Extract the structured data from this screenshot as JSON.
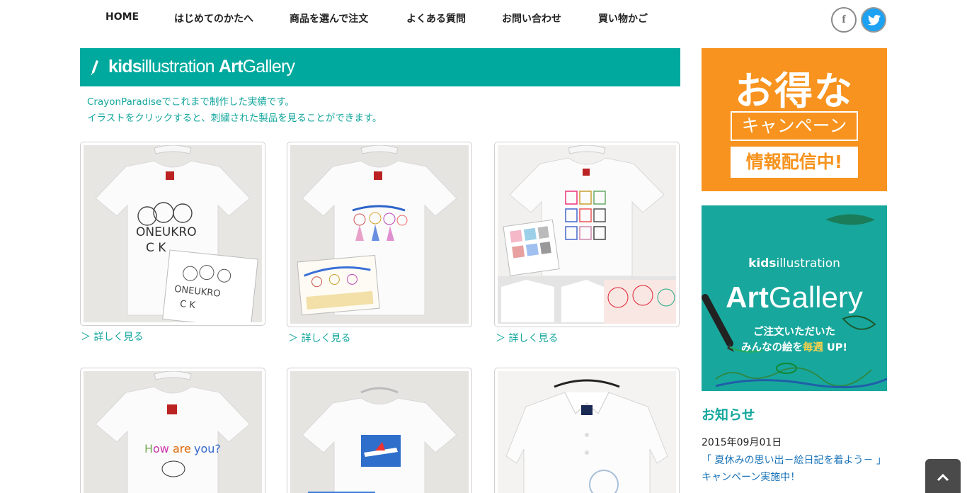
{
  "nav": {
    "items": [
      {
        "label": "HOME"
      },
      {
        "label": "はじめてのかたへ"
      },
      {
        "label": "商品を選んで注文"
      },
      {
        "label": "よくある質問"
      },
      {
        "label": "お問い合わせ"
      },
      {
        "label": "買い物かご"
      }
    ],
    "social": {
      "facebook_glyph": "f",
      "facebook_icon": "facebook-icon",
      "twitter_icon": "twitter-icon"
    }
  },
  "gallery": {
    "title_bold_1": "kids",
    "title_light": "illustration",
    "title_bold_2": "Art",
    "title_light_2": "Gallery",
    "intro_line1": "CrayonParadiseでこれまで制作した実績です。",
    "intro_line2": "イラストをクリックすると、刺繍された製品を見ることができます。",
    "more_label": "＞ 詳しく見る"
  },
  "sidebar": {
    "campaign": {
      "line1": "お得な",
      "line2": "キャンペーン",
      "line3": "情報配信中!"
    },
    "artgallery": {
      "small_bold": "kids",
      "small_light": "illustration",
      "large_bold": "Art",
      "large_light": "Gallery",
      "msg_line1": "ご注文いただいた",
      "msg_line2_a": "みんなの絵を",
      "msg_line2_b": "毎週",
      "msg_line2_c": " UP!"
    },
    "news": {
      "heading": "お知らせ",
      "date": "2015年09月01日",
      "line1": "「 夏休みの思い出－絵日記を着よう－ 」",
      "line2": "キャンペーン実施中！"
    }
  },
  "colors": {
    "teal": "#00a99d",
    "orange": "#f7931e"
  }
}
